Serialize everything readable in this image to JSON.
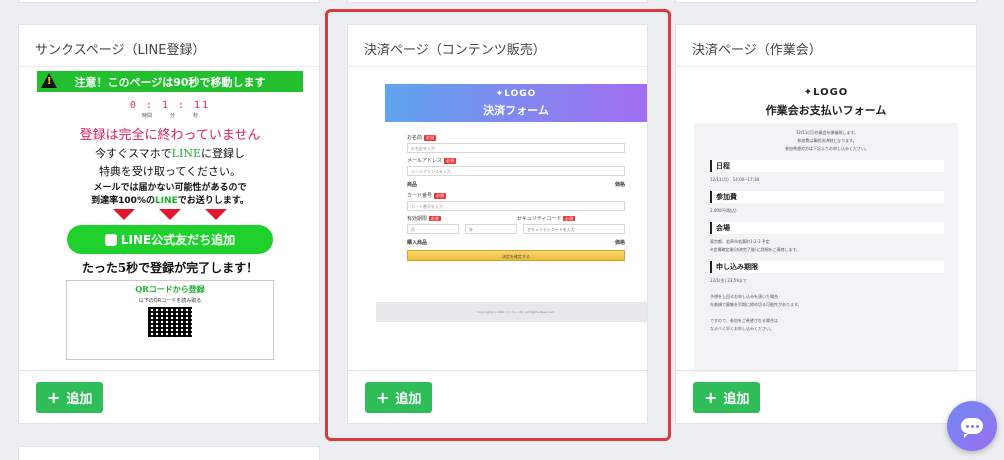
{
  "cards": [
    {
      "title": "サンクスページ（LINE登録）",
      "add_label": "追加",
      "preview": {
        "warning": "注意！このページは90秒で移動します",
        "timer": "0 : 1 : 11",
        "timer_units": [
          "時間",
          "分",
          "秒"
        ],
        "headline": "登録は完全に終わっていません",
        "line_a": "今すぐスマホで",
        "line_a_green": "LINE",
        "line_a_end": "に登録し",
        "line_b": "特典を受け取ってください。",
        "small_a": "メールでは届かない可能性があるので",
        "small_b": "到達率100%の",
        "small_b_green": "LINE",
        "small_b_end": "でお送りします。",
        "line_button": "LINE公式友だち追加",
        "five_sec": "たった5秒で登録が完了します！",
        "qr_title": "QRコードから登録",
        "qr_sub": "以下のQRコードを読み取る"
      }
    },
    {
      "title": "決済ページ（コンテンツ販売）",
      "add_label": "追加",
      "preview": {
        "logo": "LOGO",
        "form_title": "決済フォーム",
        "name_label": "お名前",
        "name_placeholder": "お名前を入力",
        "email_label": "メールアドレス",
        "email_placeholder": "メールアドレスを入力",
        "product_label": "商品",
        "price_label": "価格",
        "card_label": "カード番号",
        "card_placeholder": "カード番号を入力",
        "expiry_label": "有効期限",
        "cvc_label": "セキュリティコード",
        "month": "月",
        "year": "年",
        "cvc_placeholder": "セキュリティコードを入力",
        "purchase_label": "購入商品",
        "pay_button": "決定を確定する",
        "copyright": "Copyright(c) 2020 ○○ Co., Ltd. All Rights Reserved.",
        "required": "必須"
      }
    },
    {
      "title": "決済ページ（作業会）",
      "add_label": "追加",
      "preview": {
        "logo": "LOGO",
        "form_title": "作業会お支払いフォーム",
        "intro": [
          "12/11(月)作業会を開催致します。",
          "参加費は事前決済制となります。",
          "参加希望の方は下記よりお申し込みください。"
        ],
        "sections": [
          {
            "heading": "日程",
            "lines": [
              "12/11(月)　14:00~17:30"
            ]
          },
          {
            "heading": "参加費",
            "lines": [
              "2,000円(税込)"
            ]
          },
          {
            "heading": "会場",
            "lines": [
              "東京都、若草市若葉町1-2-3 予定",
              "※会場確定後(決済完了後)に詳細をご連絡します。"
            ]
          },
          {
            "heading": "申し込み期限",
            "lines": [
              "12/1(金) 23:59まで",
              "",
              "予想を上回るお申し込みを頂いた場合",
              "先着順で募集を早期に締め切る可能性があります。",
              "",
              "ですので、参加をご希望される場合は",
              "なるべく早くお申し込みください。"
            ]
          }
        ]
      }
    }
  ]
}
